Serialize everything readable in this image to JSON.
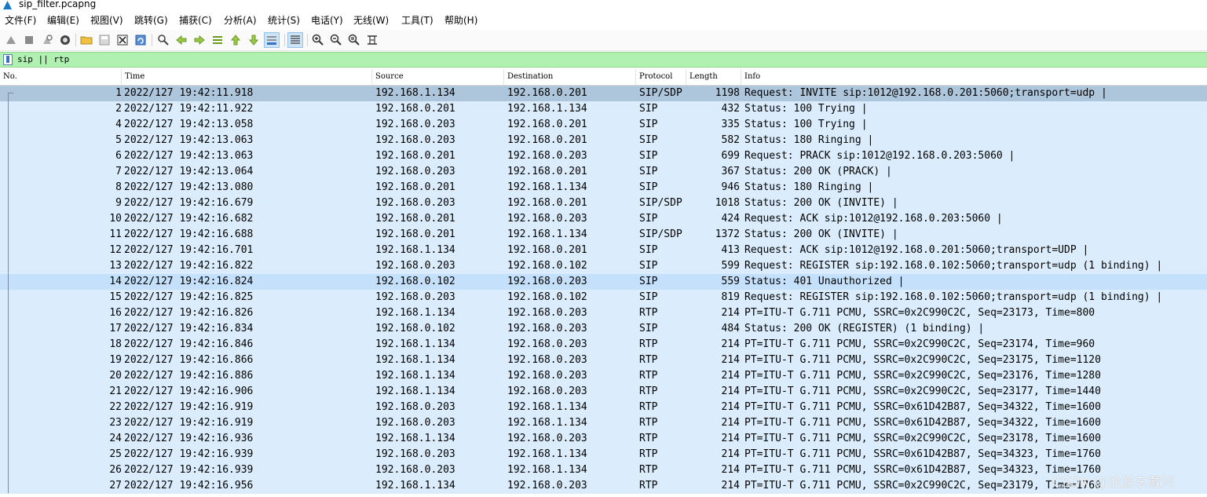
{
  "window": {
    "title": "sip_filter.pcapng"
  },
  "menu": [
    "文件(F)",
    "编辑(E)",
    "视图(V)",
    "跳转(G)",
    "捕获(C)",
    "分析(A)",
    "统计(S)",
    "电话(Y)",
    "无线(W)",
    "工具(T)",
    "帮助(H)"
  ],
  "toolbar": [
    "start-capture-icon",
    "stop-capture-icon",
    "restart-capture-icon",
    "capture-options-icon",
    "open-file-icon",
    "save-file-icon",
    "close-file-icon",
    "reload-file-icon",
    "find-packet-icon",
    "go-back-icon",
    "go-forward-icon",
    "go-to-packet-icon",
    "go-first-icon",
    "go-last-icon",
    "autoscroll-icon",
    "colorize-icon",
    "zoom-in-icon",
    "zoom-out-icon",
    "normal-size-icon",
    "resize-columns-icon"
  ],
  "filter": {
    "text": "sip || rtp",
    "bg_color": "#b0f0b0"
  },
  "columns": [
    "No.",
    "Time",
    "Source",
    "Destination",
    "Protocol",
    "Length",
    "Info"
  ],
  "packets": [
    {
      "no": "1",
      "time": "2022/127 19:42:11.918",
      "src": "192.168.1.134",
      "dst": "192.168.0.201",
      "proto": "SIP/SDP",
      "len": "1198",
      "info": "Request: INVITE sip:1012@192.168.0.201:5060;transport=udp  |"
    },
    {
      "no": "2",
      "time": "2022/127 19:42:11.922",
      "src": "192.168.0.201",
      "dst": "192.168.1.134",
      "proto": "SIP",
      "len": "432",
      "info": "Status: 100 Trying |"
    },
    {
      "no": "4",
      "time": "2022/127 19:42:13.058",
      "src": "192.168.0.203",
      "dst": "192.168.0.201",
      "proto": "SIP",
      "len": "335",
      "info": "Status: 100 Trying |"
    },
    {
      "no": "5",
      "time": "2022/127 19:42:13.063",
      "src": "192.168.0.203",
      "dst": "192.168.0.201",
      "proto": "SIP",
      "len": "582",
      "info": "Status: 180 Ringing |"
    },
    {
      "no": "6",
      "time": "2022/127 19:42:13.063",
      "src": "192.168.0.201",
      "dst": "192.168.0.203",
      "proto": "SIP",
      "len": "699",
      "info": "Request: PRACK sip:1012@192.168.0.203:5060 |"
    },
    {
      "no": "7",
      "time": "2022/127 19:42:13.064",
      "src": "192.168.0.203",
      "dst": "192.168.0.201",
      "proto": "SIP",
      "len": "367",
      "info": "Status: 200 OK (PRACK) |"
    },
    {
      "no": "8",
      "time": "2022/127 19:42:13.080",
      "src": "192.168.0.201",
      "dst": "192.168.1.134",
      "proto": "SIP",
      "len": "946",
      "info": "Status: 180 Ringing |"
    },
    {
      "no": "9",
      "time": "2022/127 19:42:16.679",
      "src": "192.168.0.203",
      "dst": "192.168.0.201",
      "proto": "SIP/SDP",
      "len": "1018",
      "info": "Status: 200 OK (INVITE) |"
    },
    {
      "no": "10",
      "time": "2022/127 19:42:16.682",
      "src": "192.168.0.201",
      "dst": "192.168.0.203",
      "proto": "SIP",
      "len": "424",
      "info": "Request: ACK sip:1012@192.168.0.203:5060 |"
    },
    {
      "no": "11",
      "time": "2022/127 19:42:16.688",
      "src": "192.168.0.201",
      "dst": "192.168.1.134",
      "proto": "SIP/SDP",
      "len": "1372",
      "info": "Status: 200 OK (INVITE) |"
    },
    {
      "no": "12",
      "time": "2022/127 19:42:16.701",
      "src": "192.168.1.134",
      "dst": "192.168.0.201",
      "proto": "SIP",
      "len": "413",
      "info": "Request: ACK sip:1012@192.168.0.201:5060;transport=UDP |"
    },
    {
      "no": "13",
      "time": "2022/127 19:42:16.822",
      "src": "192.168.0.203",
      "dst": "192.168.0.102",
      "proto": "SIP",
      "len": "599",
      "info": "Request: REGISTER sip:192.168.0.102:5060;transport=udp  (1 binding) |"
    },
    {
      "no": "14",
      "time": "2022/127 19:42:16.824",
      "src": "192.168.0.102",
      "dst": "192.168.0.203",
      "proto": "SIP",
      "len": "559",
      "info": "Status: 401 Unauthorized |"
    },
    {
      "no": "15",
      "time": "2022/127 19:42:16.825",
      "src": "192.168.0.203",
      "dst": "192.168.0.102",
      "proto": "SIP",
      "len": "819",
      "info": "Request: REGISTER sip:192.168.0.102:5060;transport=udp  (1 binding) |"
    },
    {
      "no": "16",
      "time": "2022/127 19:42:16.826",
      "src": "192.168.1.134",
      "dst": "192.168.0.203",
      "proto": "RTP",
      "len": "214",
      "info": "PT=ITU-T G.711 PCMU, SSRC=0x2C990C2C, Seq=23173, Time=800"
    },
    {
      "no": "17",
      "time": "2022/127 19:42:16.834",
      "src": "192.168.0.102",
      "dst": "192.168.0.203",
      "proto": "SIP",
      "len": "484",
      "info": "Status: 200 OK (REGISTER)  (1 binding) |"
    },
    {
      "no": "18",
      "time": "2022/127 19:42:16.846",
      "src": "192.168.1.134",
      "dst": "192.168.0.203",
      "proto": "RTP",
      "len": "214",
      "info": "PT=ITU-T G.711 PCMU, SSRC=0x2C990C2C, Seq=23174, Time=960"
    },
    {
      "no": "19",
      "time": "2022/127 19:42:16.866",
      "src": "192.168.1.134",
      "dst": "192.168.0.203",
      "proto": "RTP",
      "len": "214",
      "info": "PT=ITU-T G.711 PCMU, SSRC=0x2C990C2C, Seq=23175, Time=1120"
    },
    {
      "no": "20",
      "time": "2022/127 19:42:16.886",
      "src": "192.168.1.134",
      "dst": "192.168.0.203",
      "proto": "RTP",
      "len": "214",
      "info": "PT=ITU-T G.711 PCMU, SSRC=0x2C990C2C, Seq=23176, Time=1280"
    },
    {
      "no": "21",
      "time": "2022/127 19:42:16.906",
      "src": "192.168.1.134",
      "dst": "192.168.0.203",
      "proto": "RTP",
      "len": "214",
      "info": "PT=ITU-T G.711 PCMU, SSRC=0x2C990C2C, Seq=23177, Time=1440"
    },
    {
      "no": "22",
      "time": "2022/127 19:42:16.919",
      "src": "192.168.0.203",
      "dst": "192.168.1.134",
      "proto": "RTP",
      "len": "214",
      "info": "PT=ITU-T G.711 PCMU, SSRC=0x61D42B87, Seq=34322, Time=1600"
    },
    {
      "no": "23",
      "time": "2022/127 19:42:16.919",
      "src": "192.168.0.203",
      "dst": "192.168.1.134",
      "proto": "RTP",
      "len": "214",
      "info": "PT=ITU-T G.711 PCMU, SSRC=0x61D42B87, Seq=34322, Time=1600"
    },
    {
      "no": "24",
      "time": "2022/127 19:42:16.936",
      "src": "192.168.1.134",
      "dst": "192.168.0.203",
      "proto": "RTP",
      "len": "214",
      "info": "PT=ITU-T G.711 PCMU, SSRC=0x2C990C2C, Seq=23178, Time=1600"
    },
    {
      "no": "25",
      "time": "2022/127 19:42:16.939",
      "src": "192.168.0.203",
      "dst": "192.168.1.134",
      "proto": "RTP",
      "len": "214",
      "info": "PT=ITU-T G.711 PCMU, SSRC=0x61D42B87, Seq=34323, Time=1760"
    },
    {
      "no": "26",
      "time": "2022/127 19:42:16.939",
      "src": "192.168.0.203",
      "dst": "192.168.1.134",
      "proto": "RTP",
      "len": "214",
      "info": "PT=ITU-T G.711 PCMU, SSRC=0x61D42B87, Seq=34323, Time=1760"
    },
    {
      "no": "27",
      "time": "2022/127 19:42:16.956",
      "src": "192.168.1.134",
      "dst": "192.168.0.203",
      "proto": "RTP",
      "len": "214",
      "info": "PT=ITU-T G.711 PCMU, SSRC=0x2C990C2C, Seq=23179, Time=1760"
    }
  ],
  "selected_packet": "1",
  "hover_packet": "14",
  "row_color": "#dbedfd",
  "selected_color": "#aec6dc",
  "watermark": "CSDN @浪游东戴河"
}
